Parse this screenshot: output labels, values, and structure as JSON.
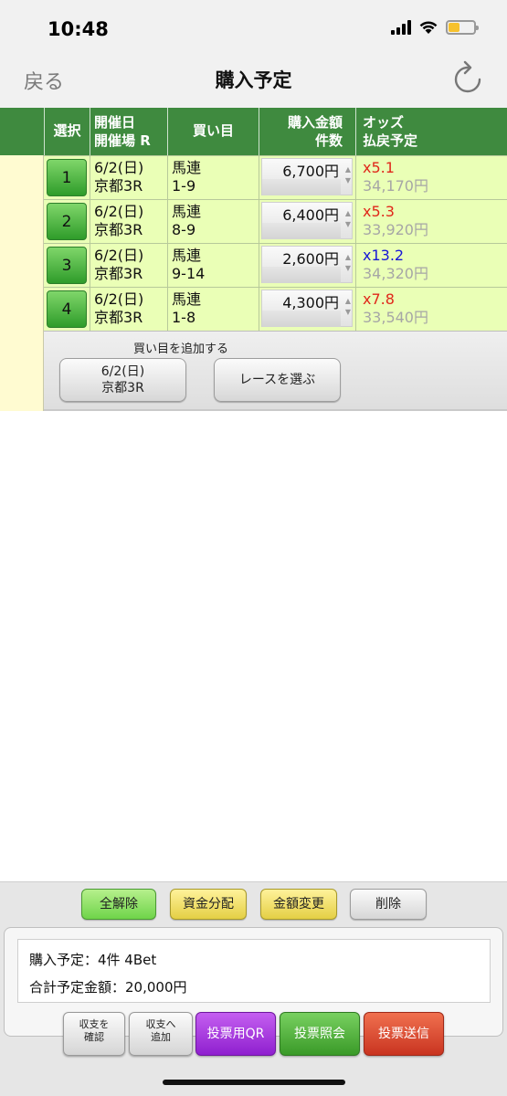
{
  "status": {
    "time": "10:48"
  },
  "nav": {
    "back": "戻る",
    "title": "購入予定"
  },
  "table": {
    "headers": {
      "select": "選択",
      "date_line1": "開催日",
      "date_line2": "開催場 R",
      "bet": "買い目",
      "amount_line1": "購入金額",
      "amount_line2": "件数",
      "odds_line1": "オッズ",
      "odds_line2": "払戻予定"
    },
    "rows": [
      {
        "no": "1",
        "date": "6/2(日)",
        "venue": "京都3R",
        "type": "馬連",
        "combo": "1-9",
        "amount": "6,700円",
        "odds": "x5.1",
        "payout": "34,170円"
      },
      {
        "no": "2",
        "date": "6/2(日)",
        "venue": "京都3R",
        "type": "馬連",
        "combo": "8-9",
        "amount": "6,400円",
        "odds": "x5.3",
        "payout": "33,920円"
      },
      {
        "no": "3",
        "date": "6/2(日)",
        "venue": "京都3R",
        "type": "馬連",
        "combo": "9-14",
        "amount": "2,600円",
        "odds": "x13.2",
        "payout": "34,320円"
      },
      {
        "no": "4",
        "date": "6/2(日)",
        "venue": "京都3R",
        "type": "馬連",
        "combo": "1-8",
        "amount": "4,300円",
        "odds": "x7.8",
        "payout": "33,540円"
      }
    ]
  },
  "add": {
    "label": "買い目を追加する",
    "date_btn_line1": "6/2(日)",
    "date_btn_line2": "京都3R",
    "race_btn": "レースを選ぶ"
  },
  "actions": {
    "clear_all": "全解除",
    "fund_split": "資金分配",
    "amount_change": "金額変更",
    "delete": "削除"
  },
  "summary": {
    "planned": "購入予定：4件 4Bet",
    "total": "合計予定金額：20,000円"
  },
  "submit": {
    "check_line1": "収支を",
    "check_line2": "確認",
    "add_line1": "収支へ",
    "add_line2": "追加",
    "qr": "投票用QR",
    "inquiry": "投票照会",
    "send": "投票送信"
  },
  "colors": {
    "header_green": "#3f8a3f",
    "row_green": "#eaffb6",
    "odds_red": "#e0271a",
    "odds_blue": "#1717d6",
    "qr_purple": "#9f2ad8",
    "inquiry_green": "#4caa38",
    "send_red": "#d8432c"
  }
}
